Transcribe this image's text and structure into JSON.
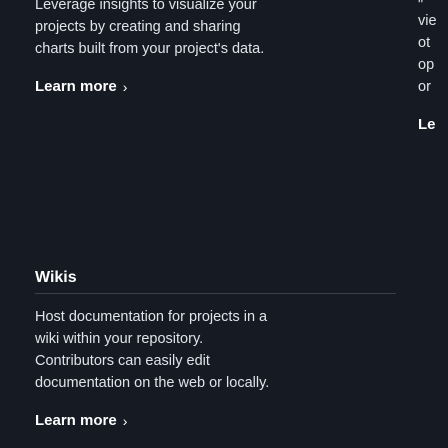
{
  "top_card": {
    "text_lines": [
      "Leverage insights to visualize your",
      "projects by creating and sharing",
      "charts built from your project's data."
    ],
    "learn_more": "Learn more",
    "arrow": "›"
  },
  "wikis_card": {
    "title": "Wikis",
    "text_lines": [
      "Host documentation for projects in a",
      "wiki within your repository.",
      "Contributors can easily edit",
      "documentation on the web or locally."
    ],
    "learn_more": "Learn more",
    "arrow": "›"
  },
  "side_column": {
    "quote": "\"",
    "fragments": [
      "vie",
      "ot",
      "op",
      "or"
    ],
    "learn_fragment": "Le"
  }
}
